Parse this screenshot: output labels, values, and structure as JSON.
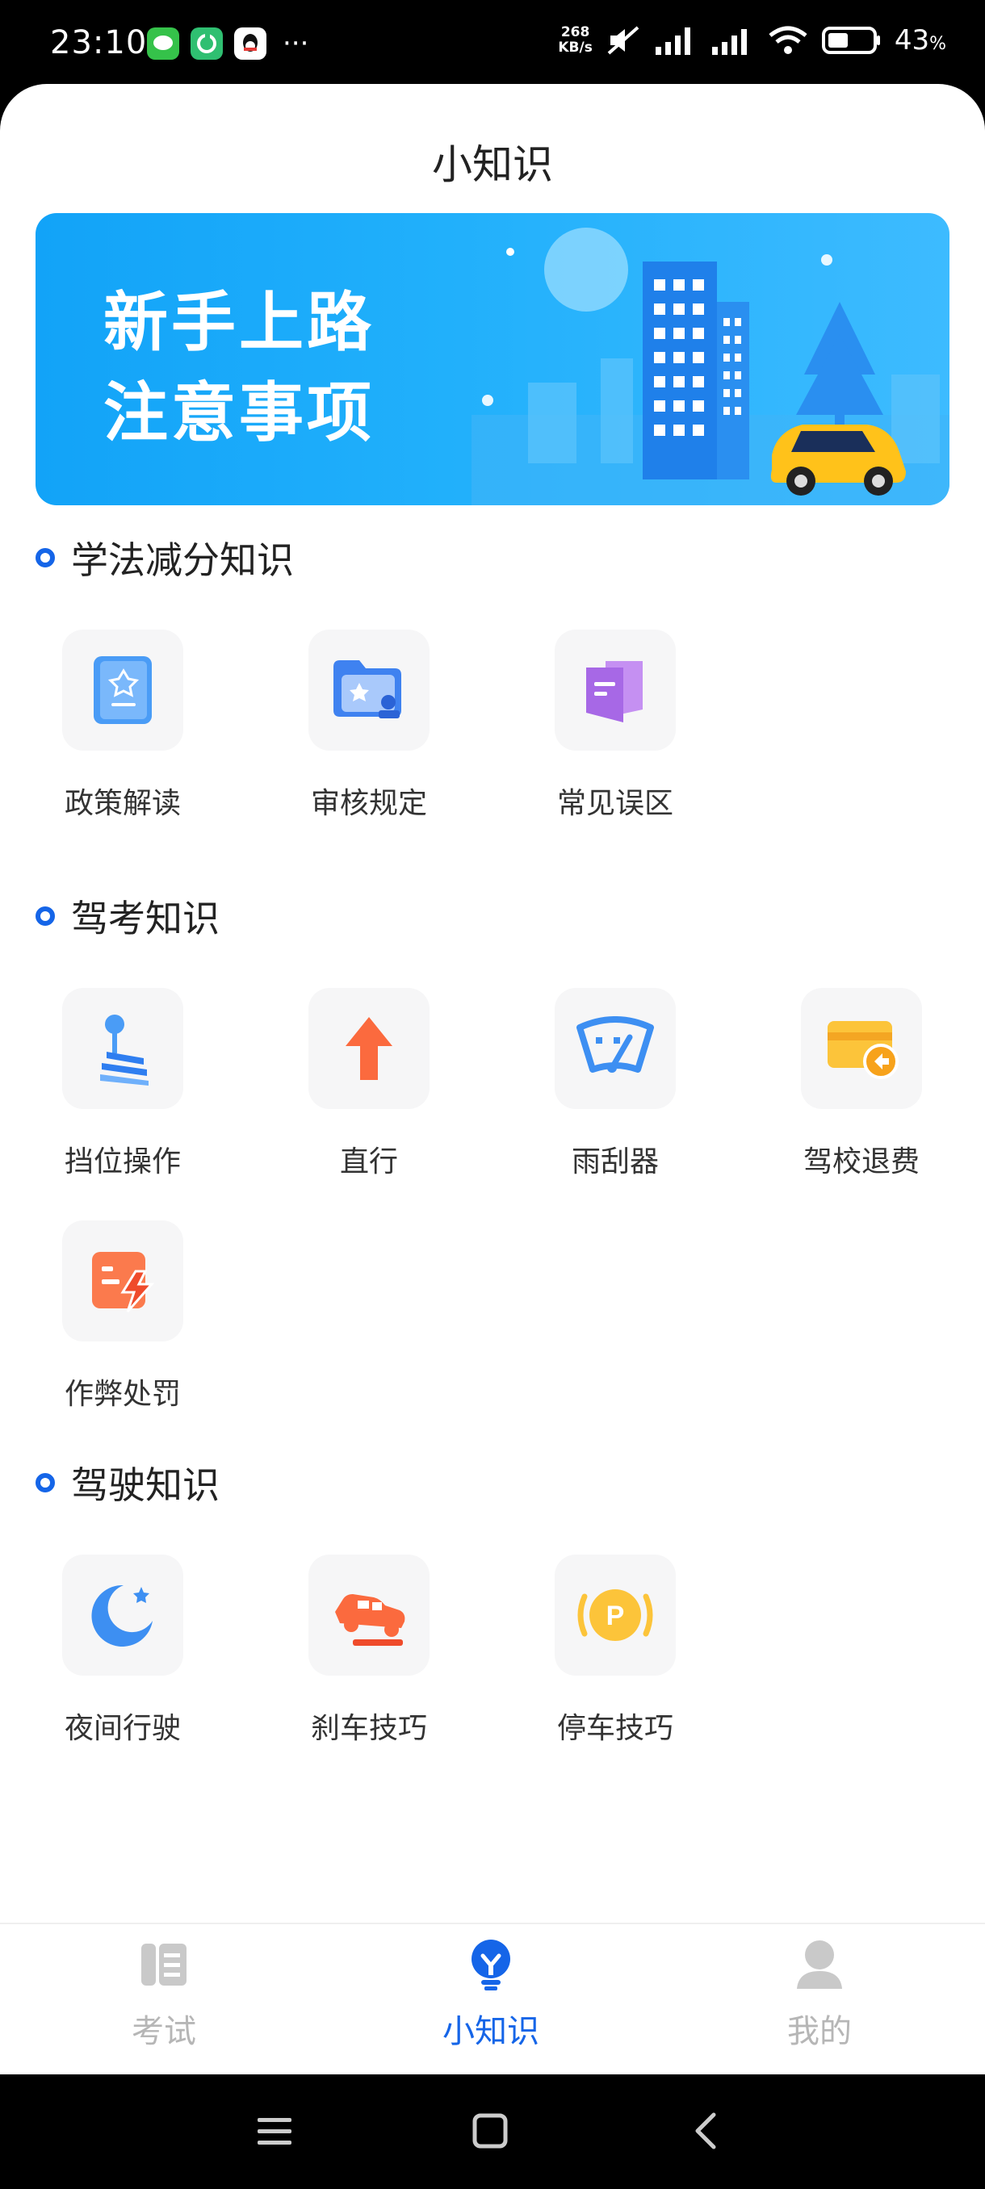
{
  "status_bar": {
    "time": "23:10",
    "more": "···",
    "net_speed_value": "268",
    "net_speed_unit": "KB/s",
    "battery_percent": "43",
    "battery_unit": "%"
  },
  "page": {
    "title": "小知识"
  },
  "banner": {
    "line1": "新手上路",
    "line2": "注意事项"
  },
  "sections": {
    "law": {
      "title": "学法减分知识",
      "items": [
        {
          "label": "政策解读",
          "icon": "policy-book-icon"
        },
        {
          "label": "审核规定",
          "icon": "review-folder-icon"
        },
        {
          "label": "常见误区",
          "icon": "misconception-icon"
        }
      ]
    },
    "exam": {
      "title": "驾考知识",
      "items": [
        {
          "label": "挡位操作",
          "icon": "gear-shift-icon"
        },
        {
          "label": "直行",
          "icon": "straight-arrow-icon"
        },
        {
          "label": "雨刮器",
          "icon": "wiper-icon"
        },
        {
          "label": "驾校退费",
          "icon": "refund-card-icon"
        },
        {
          "label": "作弊处罚",
          "icon": "cheating-penalty-icon"
        }
      ]
    },
    "driving": {
      "title": "驾驶知识",
      "items": [
        {
          "label": "夜间行驶",
          "icon": "moon-icon"
        },
        {
          "label": "刹车技巧",
          "icon": "brake-car-icon"
        },
        {
          "label": "停车技巧",
          "icon": "parking-icon"
        }
      ]
    }
  },
  "tabbar": {
    "tabs": [
      {
        "label": "考试",
        "active": false
      },
      {
        "label": "小知识",
        "active": true
      },
      {
        "label": "我的",
        "active": false
      }
    ]
  },
  "colors": {
    "accent": "#1565e8",
    "banner": "#1aa8f9",
    "inactive_tab": "#b6b6b6"
  }
}
